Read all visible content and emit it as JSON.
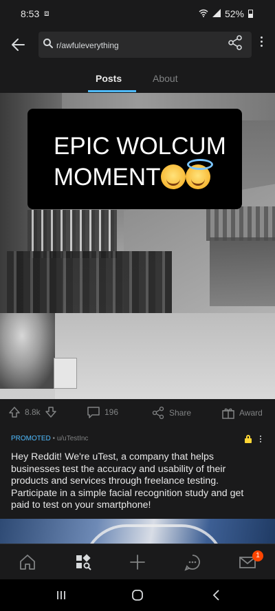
{
  "status_bar": {
    "time": "8:53",
    "battery": "52%"
  },
  "search": {
    "query": "r/awfuleverything"
  },
  "tabs": [
    {
      "label": "Posts",
      "active": true
    },
    {
      "label": "About",
      "active": false
    }
  ],
  "post": {
    "caption_line1": "EPIC WOLCUM",
    "caption_line2": "MOMENT",
    "caption_emojis": [
      "smiling-face-icon",
      "halo-face-icon"
    ]
  },
  "actions": {
    "votes": "8.8k",
    "comments": "196",
    "share_label": "Share",
    "award_label": "Award"
  },
  "ad": {
    "promoted_label": "PROMOTED",
    "separator": " • ",
    "user": "u/uTestInc",
    "body": "Hey Reddit! We're uTest, a company that helps businesses test the accuracy and usability of their products and services through freelance testing. Participate in a simple facial recognition study and get paid to test on your smartphone!"
  },
  "bottom_nav": {
    "inbox_badge": "1"
  },
  "colors": {
    "accent": "#4fbcff",
    "badge": "#ff4500",
    "lock": "#ffd635",
    "background": "#1a1a1b"
  }
}
